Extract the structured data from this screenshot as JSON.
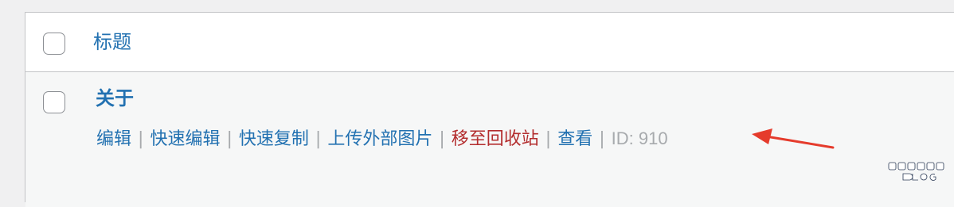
{
  "header": {
    "title_column_label": "标题"
  },
  "row": {
    "title": "关于",
    "actions": {
      "edit": "编辑",
      "quick_edit": "快速编辑",
      "quick_copy": "快速复制",
      "upload_external_images": "上传外部图片",
      "trash": "移至回收站",
      "view": "查看",
      "separator": "|",
      "post_id": "ID: 910"
    }
  },
  "annotation": {
    "arrow_color": "#e53b2c",
    "arrow_icon": "red-arrow-pointing-left-icon"
  },
  "watermark": {
    "text": "我是怀清新 BLOG"
  },
  "colors": {
    "link": "#2271b1",
    "trash": "#b32d2e",
    "muted": "#a7aaad",
    "row_bg": "#f6f7f7",
    "page_bg": "#f0f0f1"
  }
}
